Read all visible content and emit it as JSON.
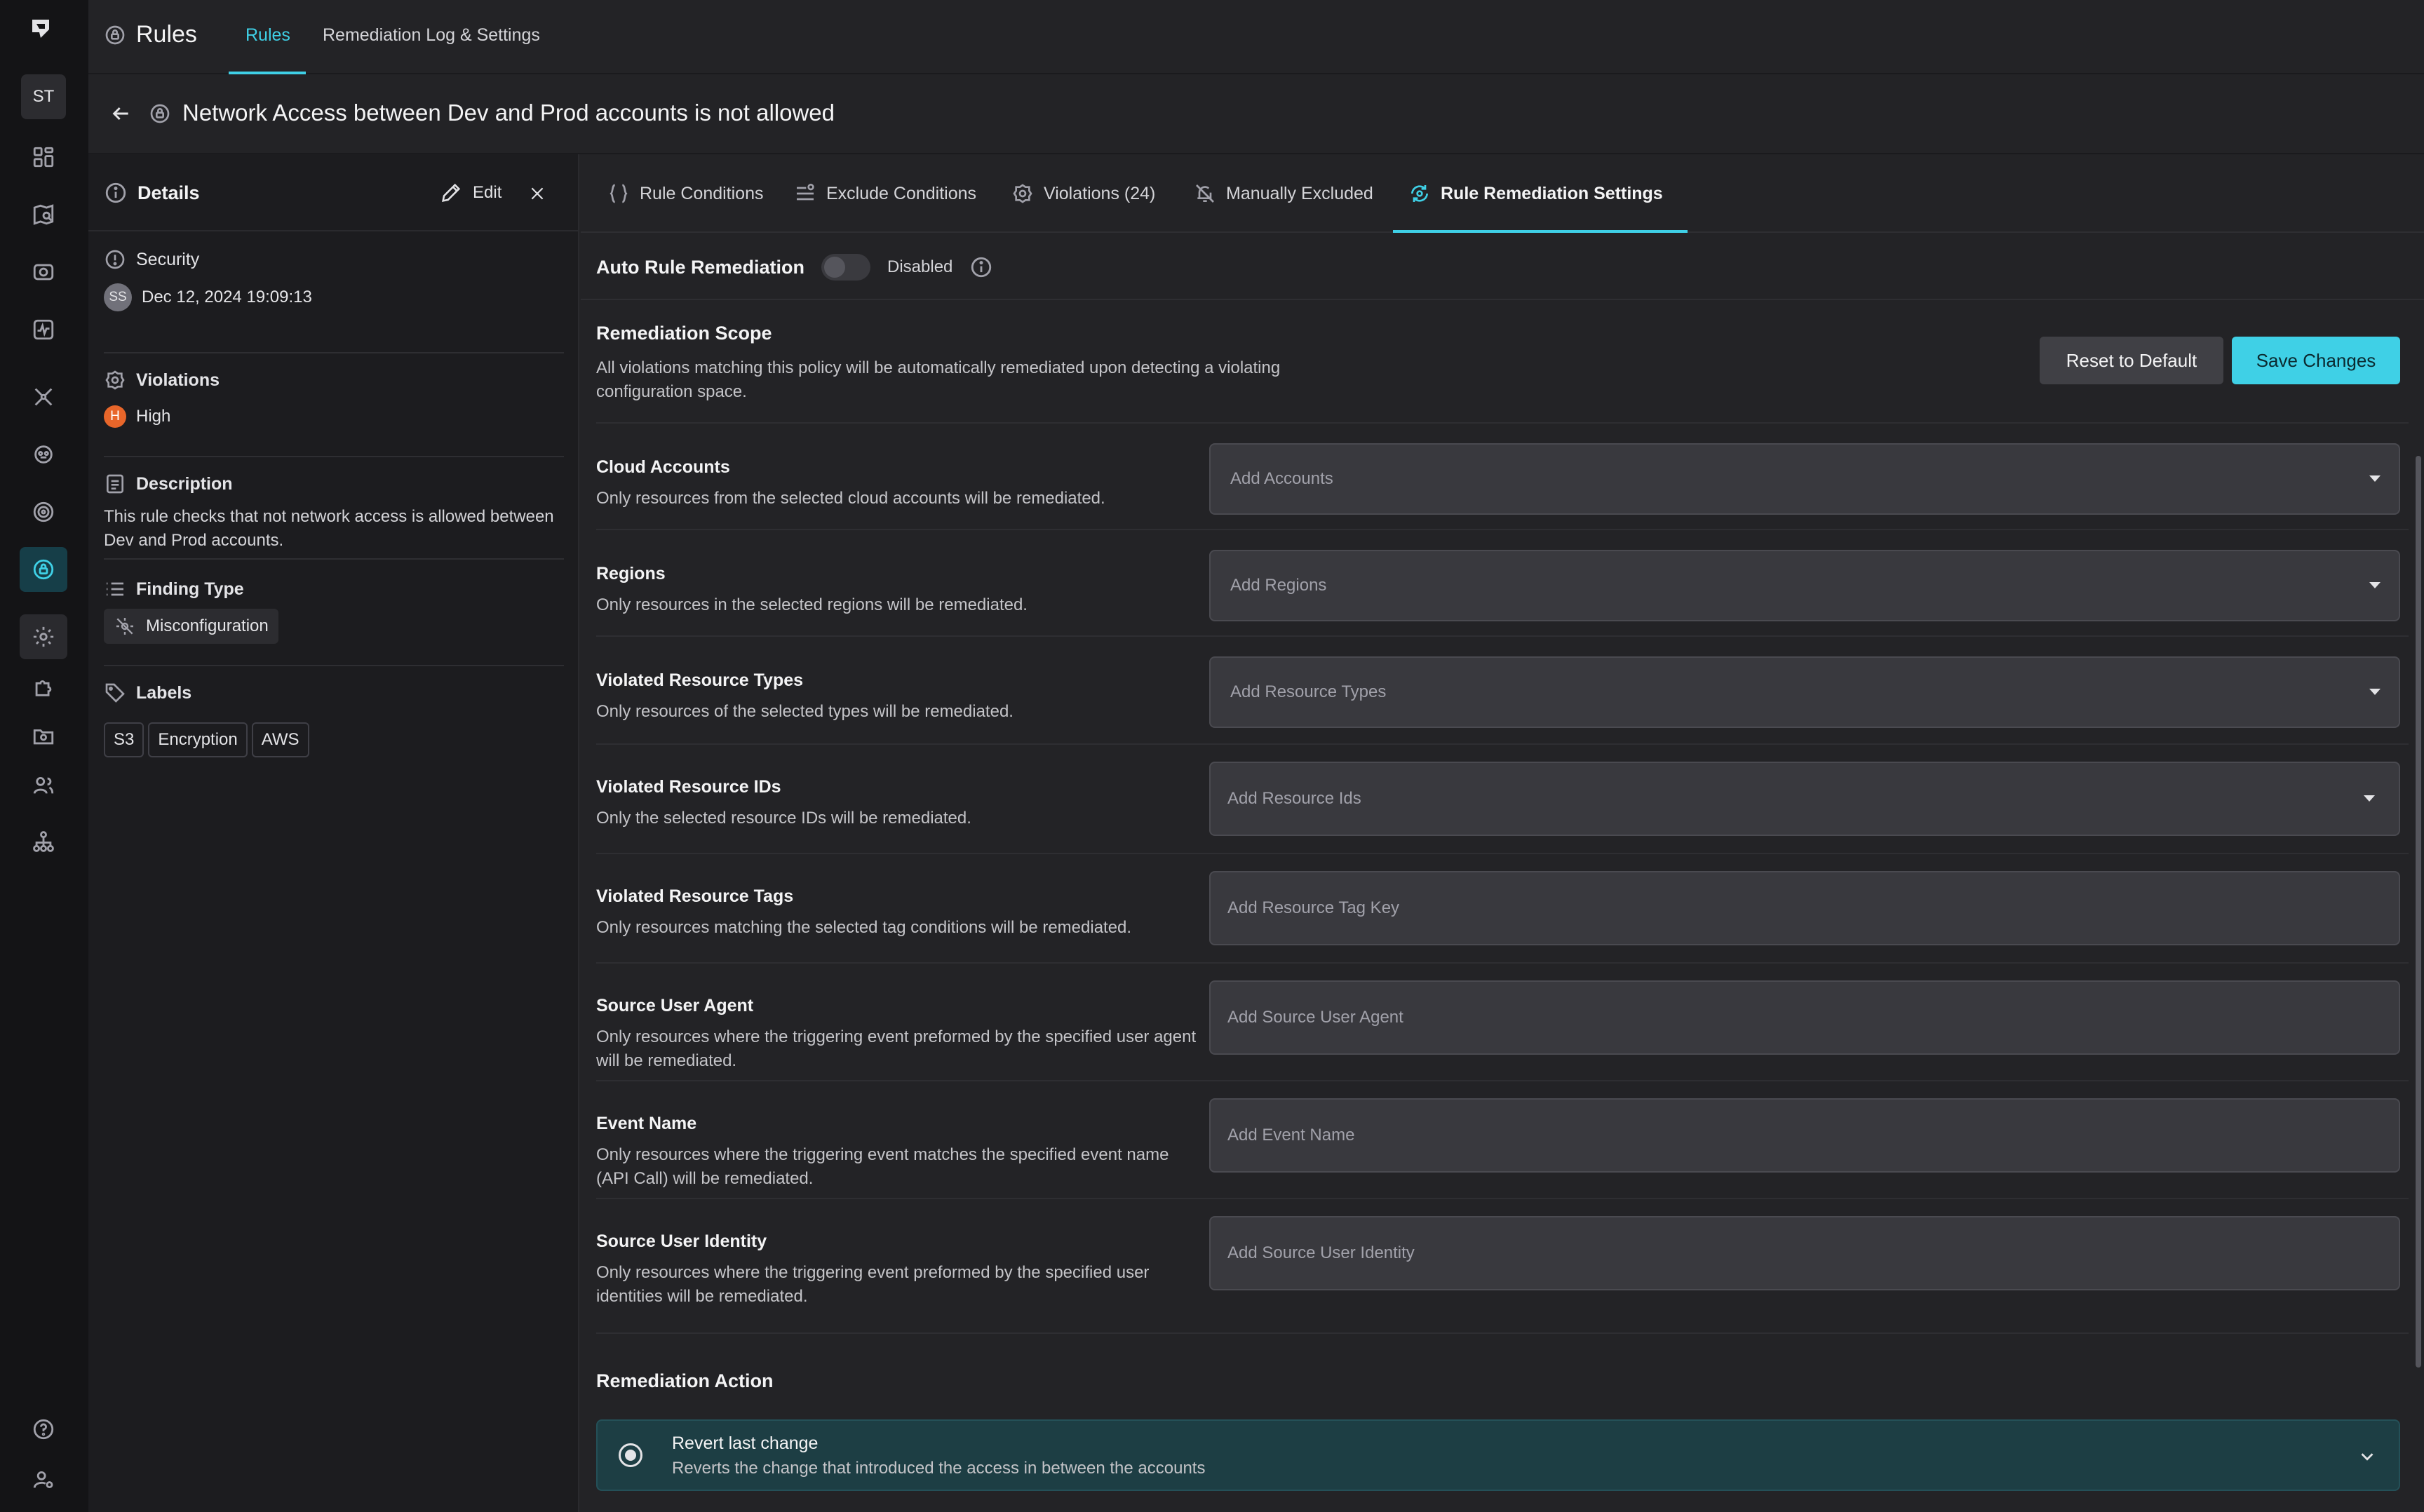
{
  "rail": {
    "avatar": "ST",
    "items": [
      {
        "icon": "dashboard-icon"
      },
      {
        "icon": "map-search-icon"
      },
      {
        "icon": "shield-camera-icon"
      },
      {
        "icon": "activity-icon"
      },
      {
        "icon": "network-icon"
      },
      {
        "icon": "bug-icon"
      },
      {
        "icon": "radar-icon"
      },
      {
        "icon": "rules-lock-icon",
        "active": true
      },
      {
        "icon": "gear-icon"
      },
      {
        "icon": "puzzle-icon"
      },
      {
        "icon": "folder-gear-icon"
      },
      {
        "icon": "users-icon"
      },
      {
        "icon": "org-chart-icon"
      },
      {
        "icon": "help-icon"
      },
      {
        "icon": "user-settings-icon"
      }
    ]
  },
  "topbar": {
    "app_title": "Rules",
    "tabs": [
      {
        "label": "Rules",
        "active": true
      },
      {
        "label": "Remediation Log & Settings",
        "active": false
      }
    ]
  },
  "page": {
    "title": "Network Access between Dev and Prod accounts is not allowed"
  },
  "details": {
    "title": "Details",
    "edit_label": "Edit",
    "category": "Security",
    "author_initials": "SS",
    "date": "Dec 12, 2024 19:09:13",
    "violations_label": "Violations",
    "severity_letter": "H",
    "severity": "High",
    "description_label": "Description",
    "description": "This rule checks that not network access is allowed between Dev and Prod accounts.",
    "finding_type_label": "Finding Type",
    "finding_type": "Misconfiguration",
    "labels_label": "Labels",
    "labels": [
      "S3",
      "Encryption",
      "AWS"
    ]
  },
  "tabs": [
    {
      "label": "Rule Conditions",
      "icon": "braces-icon"
    },
    {
      "label": "Exclude Conditions",
      "icon": "filter-list-icon"
    },
    {
      "label": "Violations (24)",
      "icon": "badge-icon"
    },
    {
      "label": "Manually Excluded",
      "icon": "bell-off-icon"
    },
    {
      "label": "Rule Remediation Settings",
      "icon": "remediation-icon",
      "active": true
    }
  ],
  "auto_remediation": {
    "label": "Auto Rule Remediation",
    "state": "Disabled"
  },
  "scope": {
    "title": "Remediation Scope",
    "description": "All violations matching this policy will be automatically remediated upon detecting a violating configuration space.",
    "reset_label": "Reset to Default",
    "save_label": "Save Changes"
  },
  "fields": [
    {
      "name": "Cloud Accounts",
      "desc": "Only resources from the selected cloud accounts will be remediated.",
      "placeholder": "Add Accounts",
      "dropdown": true
    },
    {
      "name": "Regions",
      "desc": "Only resources in the selected regions will be remediated.",
      "placeholder": "Add Regions",
      "dropdown": true
    },
    {
      "name": "Violated Resource Types",
      "desc": "Only resources of the selected types will be remediated.",
      "placeholder": "Add Resource Types",
      "dropdown": true
    },
    {
      "name": "Violated Resource IDs",
      "desc": "Only the selected resource IDs will be remediated.",
      "placeholder": "Add Resource Ids",
      "dropdown": true
    },
    {
      "name": "Violated Resource Tags",
      "desc": "Only resources matching the selected tag conditions will be remediated.",
      "placeholder": "Add Resource Tag Key",
      "dropdown": false
    },
    {
      "name": "Source User Agent",
      "desc": "Only resources where the triggering event preformed by the specified user agent will be remediated.",
      "placeholder": "Add Source User Agent",
      "dropdown": false
    },
    {
      "name": "Event Name",
      "desc": "Only resources where the triggering event matches the specified event name (API Call) will be remediated.",
      "placeholder": "Add Event Name",
      "dropdown": false
    },
    {
      "name": "Source User Identity",
      "desc": "Only resources where the triggering event preformed by the specified user identities will be remediated.",
      "placeholder": "Add Source User Identity",
      "dropdown": false
    }
  ],
  "action": {
    "title": "Remediation Action",
    "option_name": "Revert last change",
    "option_desc": "Reverts the change that introduced the access in between the accounts"
  },
  "colors": {
    "accent": "#3fd0e6",
    "severity_high": "#e8662a",
    "background": "#232326",
    "rail": "#141416"
  }
}
